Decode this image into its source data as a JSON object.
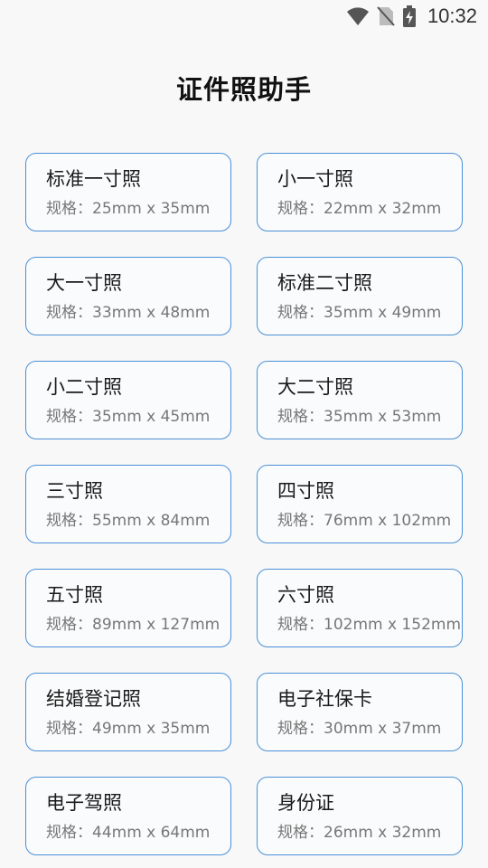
{
  "status_bar": {
    "time": "10:32",
    "icons": [
      "wifi-icon",
      "no-sim-icon",
      "battery-charging-icon"
    ]
  },
  "title": "证件照助手",
  "photo_types": [
    {
      "name": "标准一寸照",
      "spec": "规格：25mm x 35mm"
    },
    {
      "name": "小一寸照",
      "spec": "规格：22mm x 32mm"
    },
    {
      "name": "大一寸照",
      "spec": "规格：33mm x 48mm"
    },
    {
      "name": "标准二寸照",
      "spec": "规格：35mm x 49mm"
    },
    {
      "name": "小二寸照",
      "spec": "规格：35mm x 45mm"
    },
    {
      "name": "大二寸照",
      "spec": "规格：35mm x 53mm"
    },
    {
      "name": "三寸照",
      "spec": "规格：55mm x 84mm"
    },
    {
      "name": "四寸照",
      "spec": "规格：76mm x 102mm"
    },
    {
      "name": "五寸照",
      "spec": "规格：89mm x 127mm"
    },
    {
      "name": "六寸照",
      "spec": "规格：102mm x 152mm"
    },
    {
      "name": "结婚登记照",
      "spec": "规格：49mm x 35mm"
    },
    {
      "name": "电子社保卡",
      "spec": "规格：30mm x 37mm"
    },
    {
      "name": "电子驾照",
      "spec": "规格：44mm x 64mm"
    },
    {
      "name": "身份证",
      "spec": "规格：26mm x 32mm"
    }
  ],
  "colors": {
    "card_border": "#4a90d9",
    "background": "#f8f8f8",
    "spec_text": "#777777"
  }
}
